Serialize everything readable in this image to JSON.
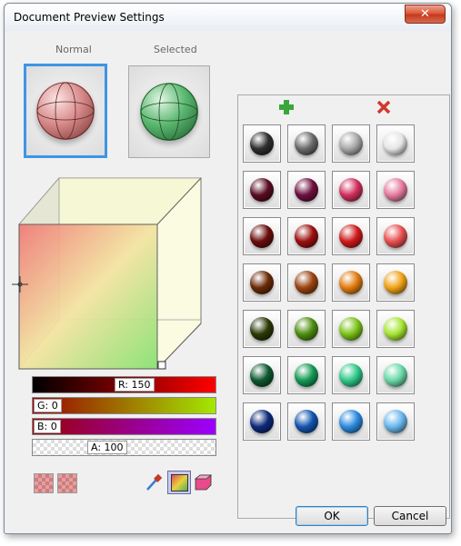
{
  "window": {
    "title": "Document Preview Settings",
    "close_glyph": "✕"
  },
  "preview": {
    "normal_label": "Normal",
    "selected_label": "Selected"
  },
  "sliders": {
    "r_label": "R: 150",
    "g_label": "G: 0",
    "b_label": "B: 0",
    "a_label": "A: 100"
  },
  "palette": {
    "add_icon": "plus-icon",
    "delete_icon": "delete-icon",
    "colors": [
      [
        "#2e2e2e",
        "#6a6a6a",
        "#a8a8a8",
        "#e6e6e6"
      ],
      [
        "#5a0d22",
        "#6e1040",
        "#d2305e",
        "#e77ca0"
      ],
      [
        "#6b0d0d",
        "#9c0f0f",
        "#cf1a1a",
        "#e85050"
      ],
      [
        "#6a2a06",
        "#9a4410",
        "#e17b10",
        "#f0a318"
      ],
      [
        "#2c3a08",
        "#4e8f10",
        "#7cc31a",
        "#a6e632"
      ],
      [
        "#0d5a30",
        "#149a55",
        "#2fc888",
        "#6ad8a8"
      ],
      [
        "#0d2a7a",
        "#1454b0",
        "#2a8ae0",
        "#6ab8ee"
      ]
    ]
  },
  "buttons": {
    "ok": "OK",
    "cancel": "Cancel"
  },
  "colors": {
    "accent": "#3d95e6",
    "normal_sphere": "#d98a8a",
    "selected_sphere": "#5ab870"
  }
}
